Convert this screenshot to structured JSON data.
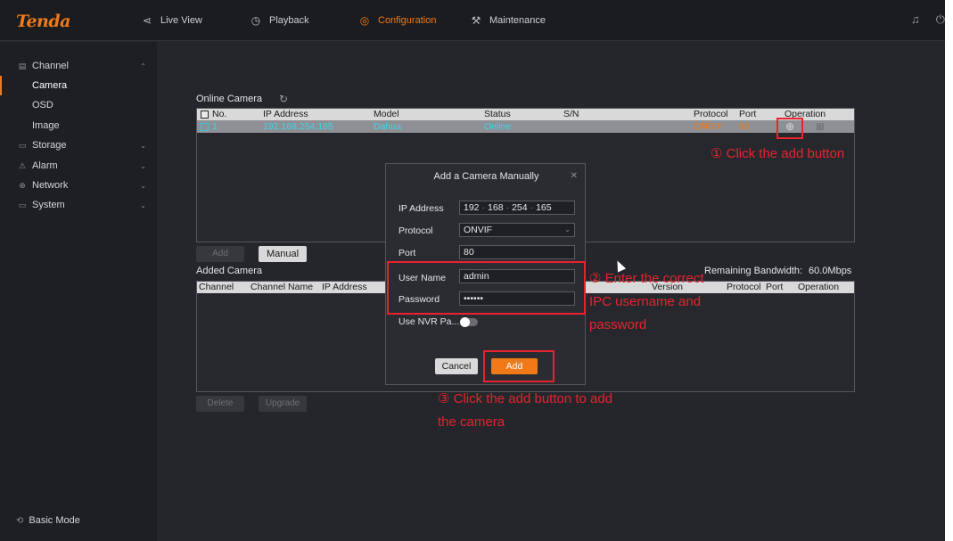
{
  "app": {
    "brand": "Tenda",
    "nav_tabs": [
      {
        "label": "Live View",
        "icon": "live-view-icon"
      },
      {
        "label": "Playback",
        "icon": "playback-icon"
      },
      {
        "label": "Configuration",
        "icon": "configuration-icon",
        "active": true
      },
      {
        "label": "Maintenance",
        "icon": "maintenance-icon"
      }
    ],
    "top_right_icons": [
      "bell-icon",
      "power-icon"
    ],
    "accent_color": "#f07a18"
  },
  "sidebar": {
    "groups": [
      {
        "label": "Channel",
        "icon": "channel-icon",
        "expanded": true,
        "items": [
          "Camera",
          "OSD",
          "Image"
        ]
      },
      {
        "label": "Storage",
        "icon": "storage-icon",
        "expanded": false
      },
      {
        "label": "Alarm",
        "icon": "alarm-icon",
        "expanded": false
      },
      {
        "label": "Network",
        "icon": "network-icon",
        "expanded": false
      },
      {
        "label": "System",
        "icon": "system-icon",
        "expanded": false
      }
    ],
    "active_item": "Camera",
    "basic_mode": "Basic Mode"
  },
  "online_camera": {
    "title": "Online Camera",
    "columns": [
      "No.",
      "IP Address",
      "Model",
      "Status",
      "S/N",
      "Protocol",
      "Port",
      "Operation"
    ],
    "rows": [
      {
        "no": "1",
        "ip": "192.168.254.165",
        "model": "Dahua",
        "status": "Online",
        "sn": "",
        "protocol": "ONVIF",
        "port": "80"
      }
    ],
    "add_button": "Add",
    "manual_button": "Manual"
  },
  "added_camera": {
    "title": "Added Camera",
    "columns": [
      "Channel",
      "Channel Name",
      "IP Address",
      "Version",
      "Protocol",
      "Port",
      "Operation"
    ],
    "remaining_bandwidth_label": "Remaining Bandwidth:",
    "remaining_bandwidth_value": "60.0Mbps",
    "delete_button": "Delete",
    "upgrade_button": "Upgrade"
  },
  "dialog": {
    "title": "Add a Camera Manually",
    "ip_label": "IP Address",
    "ip_octets": [
      "192",
      "168",
      "254",
      "165"
    ],
    "protocol_label": "Protocol",
    "protocol_value": "ONVIF",
    "port_label": "Port",
    "port_value": "80",
    "username_label": "User Name",
    "username_value": "admin",
    "password_label": "Password",
    "password_value": "••••••",
    "use_nvr_label": "Use NVR Pa...",
    "use_nvr_on": false,
    "cancel_button": "Cancel",
    "add_button": "Add"
  },
  "annotations": {
    "step1": "① Click the add button",
    "step2_line1": "② Enter the correct",
    "step2_line2": "IPC username and",
    "step2_line3": "password",
    "step3_line1": "③ Click the add button to add",
    "step3_line2": "the camera",
    "color": "#e8232e"
  }
}
